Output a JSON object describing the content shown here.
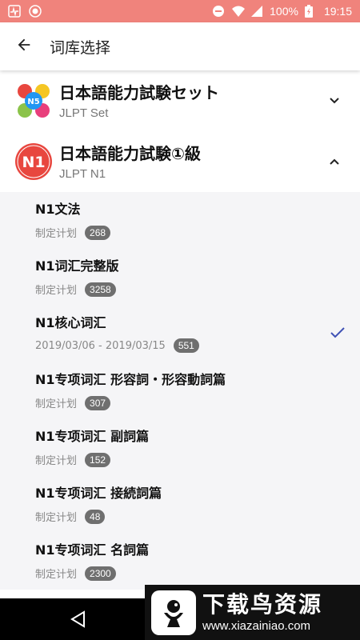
{
  "status_bar": {
    "battery_text": "100%",
    "time": "19:15",
    "bg_color": "#f0837c",
    "icons": [
      "activity-icon",
      "record-icon",
      "dnd-icon",
      "wifi-icon",
      "signal-icon",
      "battery-icon"
    ]
  },
  "app_bar": {
    "title": "词库选择",
    "back_icon": "arrow-left-icon"
  },
  "groups": [
    {
      "title": "日本語能力試験セット",
      "subtitle": "JLPT Set",
      "expanded": false,
      "logo_text": "N5",
      "chevron_icon": "chevron-down-icon"
    },
    {
      "title": "日本語能力試験①級",
      "subtitle": "JLPT N1",
      "expanded": true,
      "logo_text": "N1",
      "chevron_icon": "chevron-up-icon"
    }
  ],
  "items": [
    {
      "name": "N1文法",
      "plan": "制定计划",
      "count": "268",
      "selected": false
    },
    {
      "name": "N1词汇完整版",
      "plan": "制定计划",
      "count": "3258",
      "selected": false
    },
    {
      "name": "N1核心词汇",
      "plan": "2019/03/06 - 2019/03/15",
      "count": "551",
      "selected": true
    },
    {
      "name": "N1专项词汇 形容詞・形容動詞篇",
      "plan": "制定计划",
      "count": "307",
      "selected": false
    },
    {
      "name": "N1专项词汇 副詞篇",
      "plan": "制定计划",
      "count": "152",
      "selected": false
    },
    {
      "name": "N1专项词汇 接続詞篇",
      "plan": "制定计划",
      "count": "48",
      "selected": false
    },
    {
      "name": "N1专项词汇 名詞篇",
      "plan": "制定计划",
      "count": "2300",
      "selected": false
    }
  ],
  "colors": {
    "accent_check": "#3f51b5",
    "n1_logo": "#e8473f",
    "badge": "#6f6f6f"
  },
  "watermark": {
    "title": "下载鸟资源",
    "url": "www.xiazainiao.com"
  }
}
